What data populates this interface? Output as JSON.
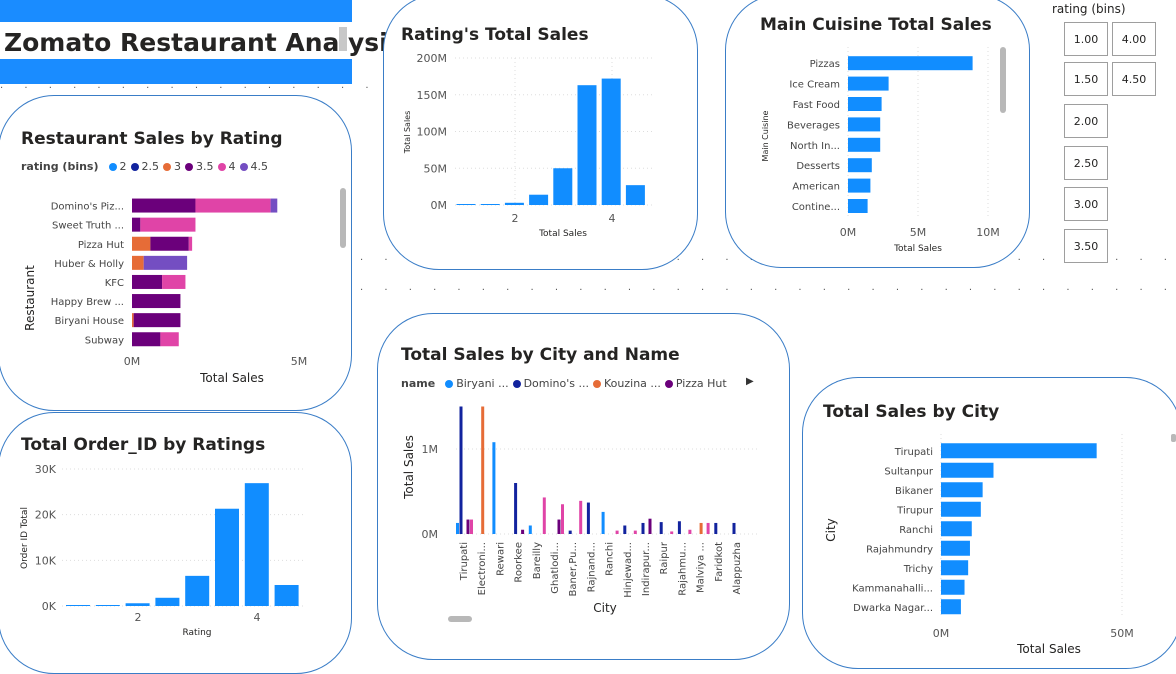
{
  "header": {
    "title": "Zomato Restaurant Analysis"
  },
  "colors": {
    "blue": "#118DFF",
    "navy": "#12239E",
    "orange": "#E66C37",
    "purple": "#6B007B",
    "pink": "#E044A7",
    "violet": "#744EC2",
    "header_bar": "#1a8cff"
  },
  "slicer": {
    "title": "rating (bins)",
    "options": [
      "1.00",
      "4.00",
      "1.50",
      "4.50",
      "2.00",
      "2.50",
      "3.00",
      "3.50"
    ]
  },
  "restaurant_sales": {
    "title": "Restaurant Sales by Rating",
    "legend_title": "rating (bins)",
    "legend": [
      {
        "label": "2",
        "color": "#118DFF"
      },
      {
        "label": "2.5",
        "color": "#12239E"
      },
      {
        "label": "3",
        "color": "#E66C37"
      },
      {
        "label": "3.5",
        "color": "#6B007B"
      },
      {
        "label": "4",
        "color": "#E044A7"
      },
      {
        "label": "4.5",
        "color": "#744EC2"
      }
    ],
    "ylabel": "Restaurant",
    "xlabel": "Total Sales",
    "x_ticks": [
      "0M",
      "5M"
    ]
  },
  "ratings_sales": {
    "title": "Rating's Total Sales",
    "ylabel": "Total Sales",
    "xlabel": "Total Sales",
    "y_ticks": [
      "0M",
      "50M",
      "100M",
      "150M",
      "200M"
    ],
    "x_ticks": [
      "2",
      "4"
    ]
  },
  "cuisine_sales": {
    "title": "Main Cuisine Total Sales",
    "ylabel": "Main Cuisine",
    "xlabel": "Total Sales",
    "x_ticks": [
      "0M",
      "5M",
      "10M"
    ]
  },
  "orders_by_rating": {
    "title": "Total Order_ID by Ratings",
    "ylabel": "Order ID Total",
    "xlabel": "Rating",
    "y_ticks": [
      "0K",
      "10K",
      "20K",
      "30K"
    ],
    "x_ticks": [
      "2",
      "4"
    ]
  },
  "city_name_sales": {
    "title": "Total Sales by City and Name",
    "legend_title": "name",
    "legend": [
      {
        "label": "Biryani ...",
        "color": "#118DFF"
      },
      {
        "label": "Domino's ...",
        "color": "#12239E"
      },
      {
        "label": "Kouzina ...",
        "color": "#E66C37"
      },
      {
        "label": "Pizza Hut",
        "color": "#6B007B"
      }
    ],
    "ylabel": "Total Sales",
    "xlabel": "City",
    "y_ticks": [
      "0M",
      "1M"
    ]
  },
  "city_sales": {
    "title": "Total Sales by City",
    "ylabel": "City",
    "xlabel": "Total Sales",
    "x_ticks": [
      "0M",
      "50M"
    ]
  },
  "chart_data": [
    {
      "type": "bar",
      "title": "Restaurant Sales by Rating",
      "orientation": "horizontal",
      "stacked": true,
      "categories": [
        "Domino's Piz...",
        "Sweet Truth ...",
        "Pizza Hut",
        "Huber & Holly",
        "KFC",
        "Happy Brew ...",
        "Biryani House",
        "Subway"
      ],
      "series": [
        {
          "name": "2.5",
          "color": "#12239E",
          "values": [
            0,
            0,
            0,
            0,
            0,
            0,
            0,
            0
          ]
        },
        {
          "name": "3",
          "color": "#E66C37",
          "values": [
            0,
            0,
            0.55,
            0.35,
            0,
            0,
            0.05,
            0
          ]
        },
        {
          "name": "3.5",
          "color": "#6B007B",
          "values": [
            1.9,
            0.25,
            1.15,
            0,
            0.9,
            1.45,
            1.4,
            0.85
          ]
        },
        {
          "name": "4",
          "color": "#E044A7",
          "values": [
            2.25,
            1.65,
            0.1,
            0,
            0.7,
            0,
            0,
            0.55
          ]
        },
        {
          "name": "4.5",
          "color": "#744EC2",
          "values": [
            0.2,
            0,
            0,
            1.3,
            0,
            0,
            0,
            0
          ]
        }
      ],
      "xlabel": "Total Sales",
      "ylabel": "Restaurant",
      "xlim": [
        0,
        6
      ]
    },
    {
      "type": "bar",
      "title": "Rating's Total Sales",
      "x": [
        1.0,
        1.5,
        2.0,
        2.5,
        3.0,
        3.5,
        4.0,
        4.5
      ],
      "values": [
        1,
        1,
        3,
        14,
        50,
        163,
        172,
        27
      ],
      "xlabel": "Total Sales",
      "ylabel": "Total Sales",
      "ylim": [
        0,
        200
      ]
    },
    {
      "type": "bar",
      "title": "Main Cuisine Total Sales",
      "orientation": "horizontal",
      "categories": [
        "Pizzas",
        "Ice Cream",
        "Fast Food",
        "Beverages",
        "North In...",
        "Desserts",
        "American",
        "Contine..."
      ],
      "values": [
        8.9,
        2.9,
        2.4,
        2.3,
        2.3,
        1.7,
        1.6,
        1.4
      ],
      "xlabel": "Total Sales",
      "ylabel": "Main Cuisine",
      "xlim": [
        0,
        11
      ]
    },
    {
      "type": "bar",
      "title": "Total Order_ID by Ratings",
      "x": [
        1.0,
        1.5,
        2.0,
        2.5,
        3.0,
        3.5,
        4.0,
        4.5
      ],
      "values": [
        0.2,
        0.2,
        0.6,
        1.8,
        6.6,
        21.3,
        26.9,
        4.6
      ],
      "xlabel": "Rating",
      "ylabel": "Order ID Total",
      "ylim": [
        0,
        30
      ]
    },
    {
      "type": "bar",
      "title": "Total Sales by City and Name",
      "categories": [
        "Tirupati",
        "Electroni...",
        "Rewari",
        "Roorkee",
        "Bareilly",
        "Ghatlodi...",
        "Baner,Pu...",
        "Rajnand...",
        "Ranchi",
        "Hinjewad...",
        "Indirapur...",
        "Raipur",
        "Rajahmu...",
        "Malviya ...",
        "Faridkot",
        "Alappuzha"
      ],
      "series": [
        {
          "name": "Biryani ...",
          "color": "#118DFF",
          "values": [
            0.13,
            0,
            1.08,
            0,
            0.1,
            0,
            0,
            0,
            0.26,
            0,
            0,
            0,
            0,
            0,
            0,
            0
          ]
        },
        {
          "name": "Domino's ...",
          "color": "#12239E",
          "values": [
            1.5,
            0,
            0,
            0.6,
            0,
            0,
            0.04,
            0.37,
            0,
            0.1,
            0.13,
            0.14,
            0.15,
            0,
            0.13,
            0.13
          ]
        },
        {
          "name": "Kouzina ...",
          "color": "#E66C37",
          "values": [
            0,
            1.5,
            0,
            0,
            0,
            0,
            0,
            0,
            0,
            0,
            0,
            0,
            0,
            0.13,
            0,
            0
          ]
        },
        {
          "name": "Pizza Hut",
          "color": "#6B007B",
          "values": [
            0.17,
            0,
            0,
            0.05,
            0,
            0.17,
            0,
            0,
            0,
            0,
            0.18,
            0,
            0,
            0,
            0,
            0
          ]
        },
        {
          "name": "",
          "color": "#E044A7",
          "values": [
            0.17,
            0,
            0,
            0,
            0.43,
            0.35,
            0.39,
            0,
            0.04,
            0.04,
            0,
            0.03,
            0.05,
            0.13,
            0,
            0
          ]
        }
      ],
      "xlabel": "City",
      "ylabel": "Total Sales",
      "ylim": [
        0,
        1.6
      ]
    },
    {
      "type": "bar",
      "title": "Total Sales by City",
      "orientation": "horizontal",
      "categories": [
        "Tirupati",
        "Sultanpur",
        "Bikaner",
        "Tirupur",
        "Ranchi",
        "Rajahmundry",
        "Trichy",
        "Kammanahalli...",
        "Dwarka Nagar..."
      ],
      "values": [
        43,
        14.5,
        11.5,
        11,
        8.5,
        8,
        7.5,
        6.5,
        5.5
      ],
      "xlabel": "Total Sales",
      "ylabel": "City",
      "xlim": [
        0,
        55
      ]
    }
  ]
}
